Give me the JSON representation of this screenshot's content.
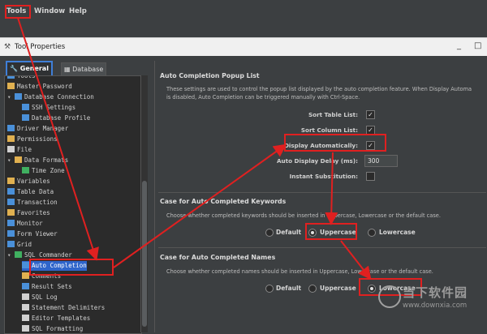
{
  "menubar": {
    "items": [
      "Tools",
      "Window",
      "Help"
    ]
  },
  "dialog": {
    "title": "Tool Properties",
    "minimize": "_",
    "maximize": "□"
  },
  "tabs": [
    {
      "label": "General"
    },
    {
      "label": "Database"
    }
  ],
  "tree": [
    {
      "label": "Tools",
      "indent": 0,
      "icon": "folder",
      "color": "#4a90d9"
    },
    {
      "label": "Master Password",
      "indent": 0,
      "icon": "key",
      "color": "#e0b050"
    },
    {
      "label": "Database Connection",
      "indent": 0,
      "icon": "db",
      "color": "#4a90d9"
    },
    {
      "label": "SSH Settings",
      "indent": 2,
      "icon": "ssh",
      "color": "#4a90d9"
    },
    {
      "label": "Database Profile",
      "indent": 2,
      "icon": "db",
      "color": "#4a90d9"
    },
    {
      "label": "Driver Manager",
      "indent": 0,
      "icon": "driver",
      "color": "#4a90d9"
    },
    {
      "label": "Permissions",
      "indent": 0,
      "icon": "key",
      "color": "#e0b050"
    },
    {
      "label": "File",
      "indent": 0,
      "icon": "file",
      "color": "#d0d0d0"
    },
    {
      "label": "Data Formats",
      "indent": 0,
      "icon": "fmt",
      "color": "#e0b050"
    },
    {
      "label": "Time Zone",
      "indent": 2,
      "icon": "globe",
      "color": "#40b060"
    },
    {
      "label": "Variables",
      "indent": 0,
      "icon": "var",
      "color": "#e0b050"
    },
    {
      "label": "Table Data",
      "indent": 0,
      "icon": "table",
      "color": "#4a90d9"
    },
    {
      "label": "Transaction",
      "indent": 0,
      "icon": "tx",
      "color": "#4a90d9"
    },
    {
      "label": "Favorites",
      "indent": 0,
      "icon": "star",
      "color": "#e0b050"
    },
    {
      "label": "Monitor",
      "indent": 0,
      "icon": "monitor",
      "color": "#4a90d9"
    },
    {
      "label": "Form Viewer",
      "indent": 0,
      "icon": "form",
      "color": "#4a90d9"
    },
    {
      "label": "Grid",
      "indent": 0,
      "icon": "grid",
      "color": "#4a90d9"
    },
    {
      "label": "SQL Commander",
      "indent": 0,
      "icon": "play",
      "color": "#40b060"
    },
    {
      "label": "Auto Completion",
      "indent": 2,
      "icon": "ac",
      "color": "#4a90d9",
      "selected": true
    },
    {
      "label": "Comments",
      "indent": 2,
      "icon": "folder",
      "color": "#e0b050"
    },
    {
      "label": "Result Sets",
      "indent": 2,
      "icon": "table",
      "color": "#4a90d9"
    },
    {
      "label": "SQL Log",
      "indent": 2,
      "icon": "file",
      "color": "#d0d0d0"
    },
    {
      "label": "Statement Delimiters",
      "indent": 2,
      "icon": "file",
      "color": "#d0d0d0"
    },
    {
      "label": "Editor Templates",
      "indent": 2,
      "icon": "file",
      "color": "#d0d0d0"
    },
    {
      "label": "SQL Formatting",
      "indent": 2,
      "icon": "file",
      "color": "#d0d0d0"
    }
  ],
  "popup": {
    "title": "Auto Completion Popup List",
    "desc1": "These settings are used to control the popup list displayed by the auto completion feature. When Display Automa",
    "desc2": "is disabled, Auto Completion can be triggered manually with Ctrl-Space.",
    "sort_table": "Sort Table List:",
    "sort_column": "Sort Column List:",
    "display_auto": "Display Automatically:",
    "delay_label": "Auto Display Delay (ms):",
    "delay_value": "300",
    "instant": "Instant Substitution:"
  },
  "keywords": {
    "title": "Case for Auto Completed Keywords",
    "desc": "Choose whether completed keywords should be inserted in Uppercase, Lowercase or the default case.",
    "opt_default": "Default",
    "opt_upper": "Uppercase",
    "opt_lower": "Lowercase"
  },
  "names": {
    "title": "Case for Auto Completed Names",
    "desc": "Choose whether completed names should be inserted in Uppercase, Lowercase or the default case.",
    "opt_default": "Default",
    "opt_upper": "Uppercase",
    "opt_lower": "Lowercase"
  },
  "watermark": {
    "cn": "当下软件园",
    "url": "www.downxia.com"
  }
}
